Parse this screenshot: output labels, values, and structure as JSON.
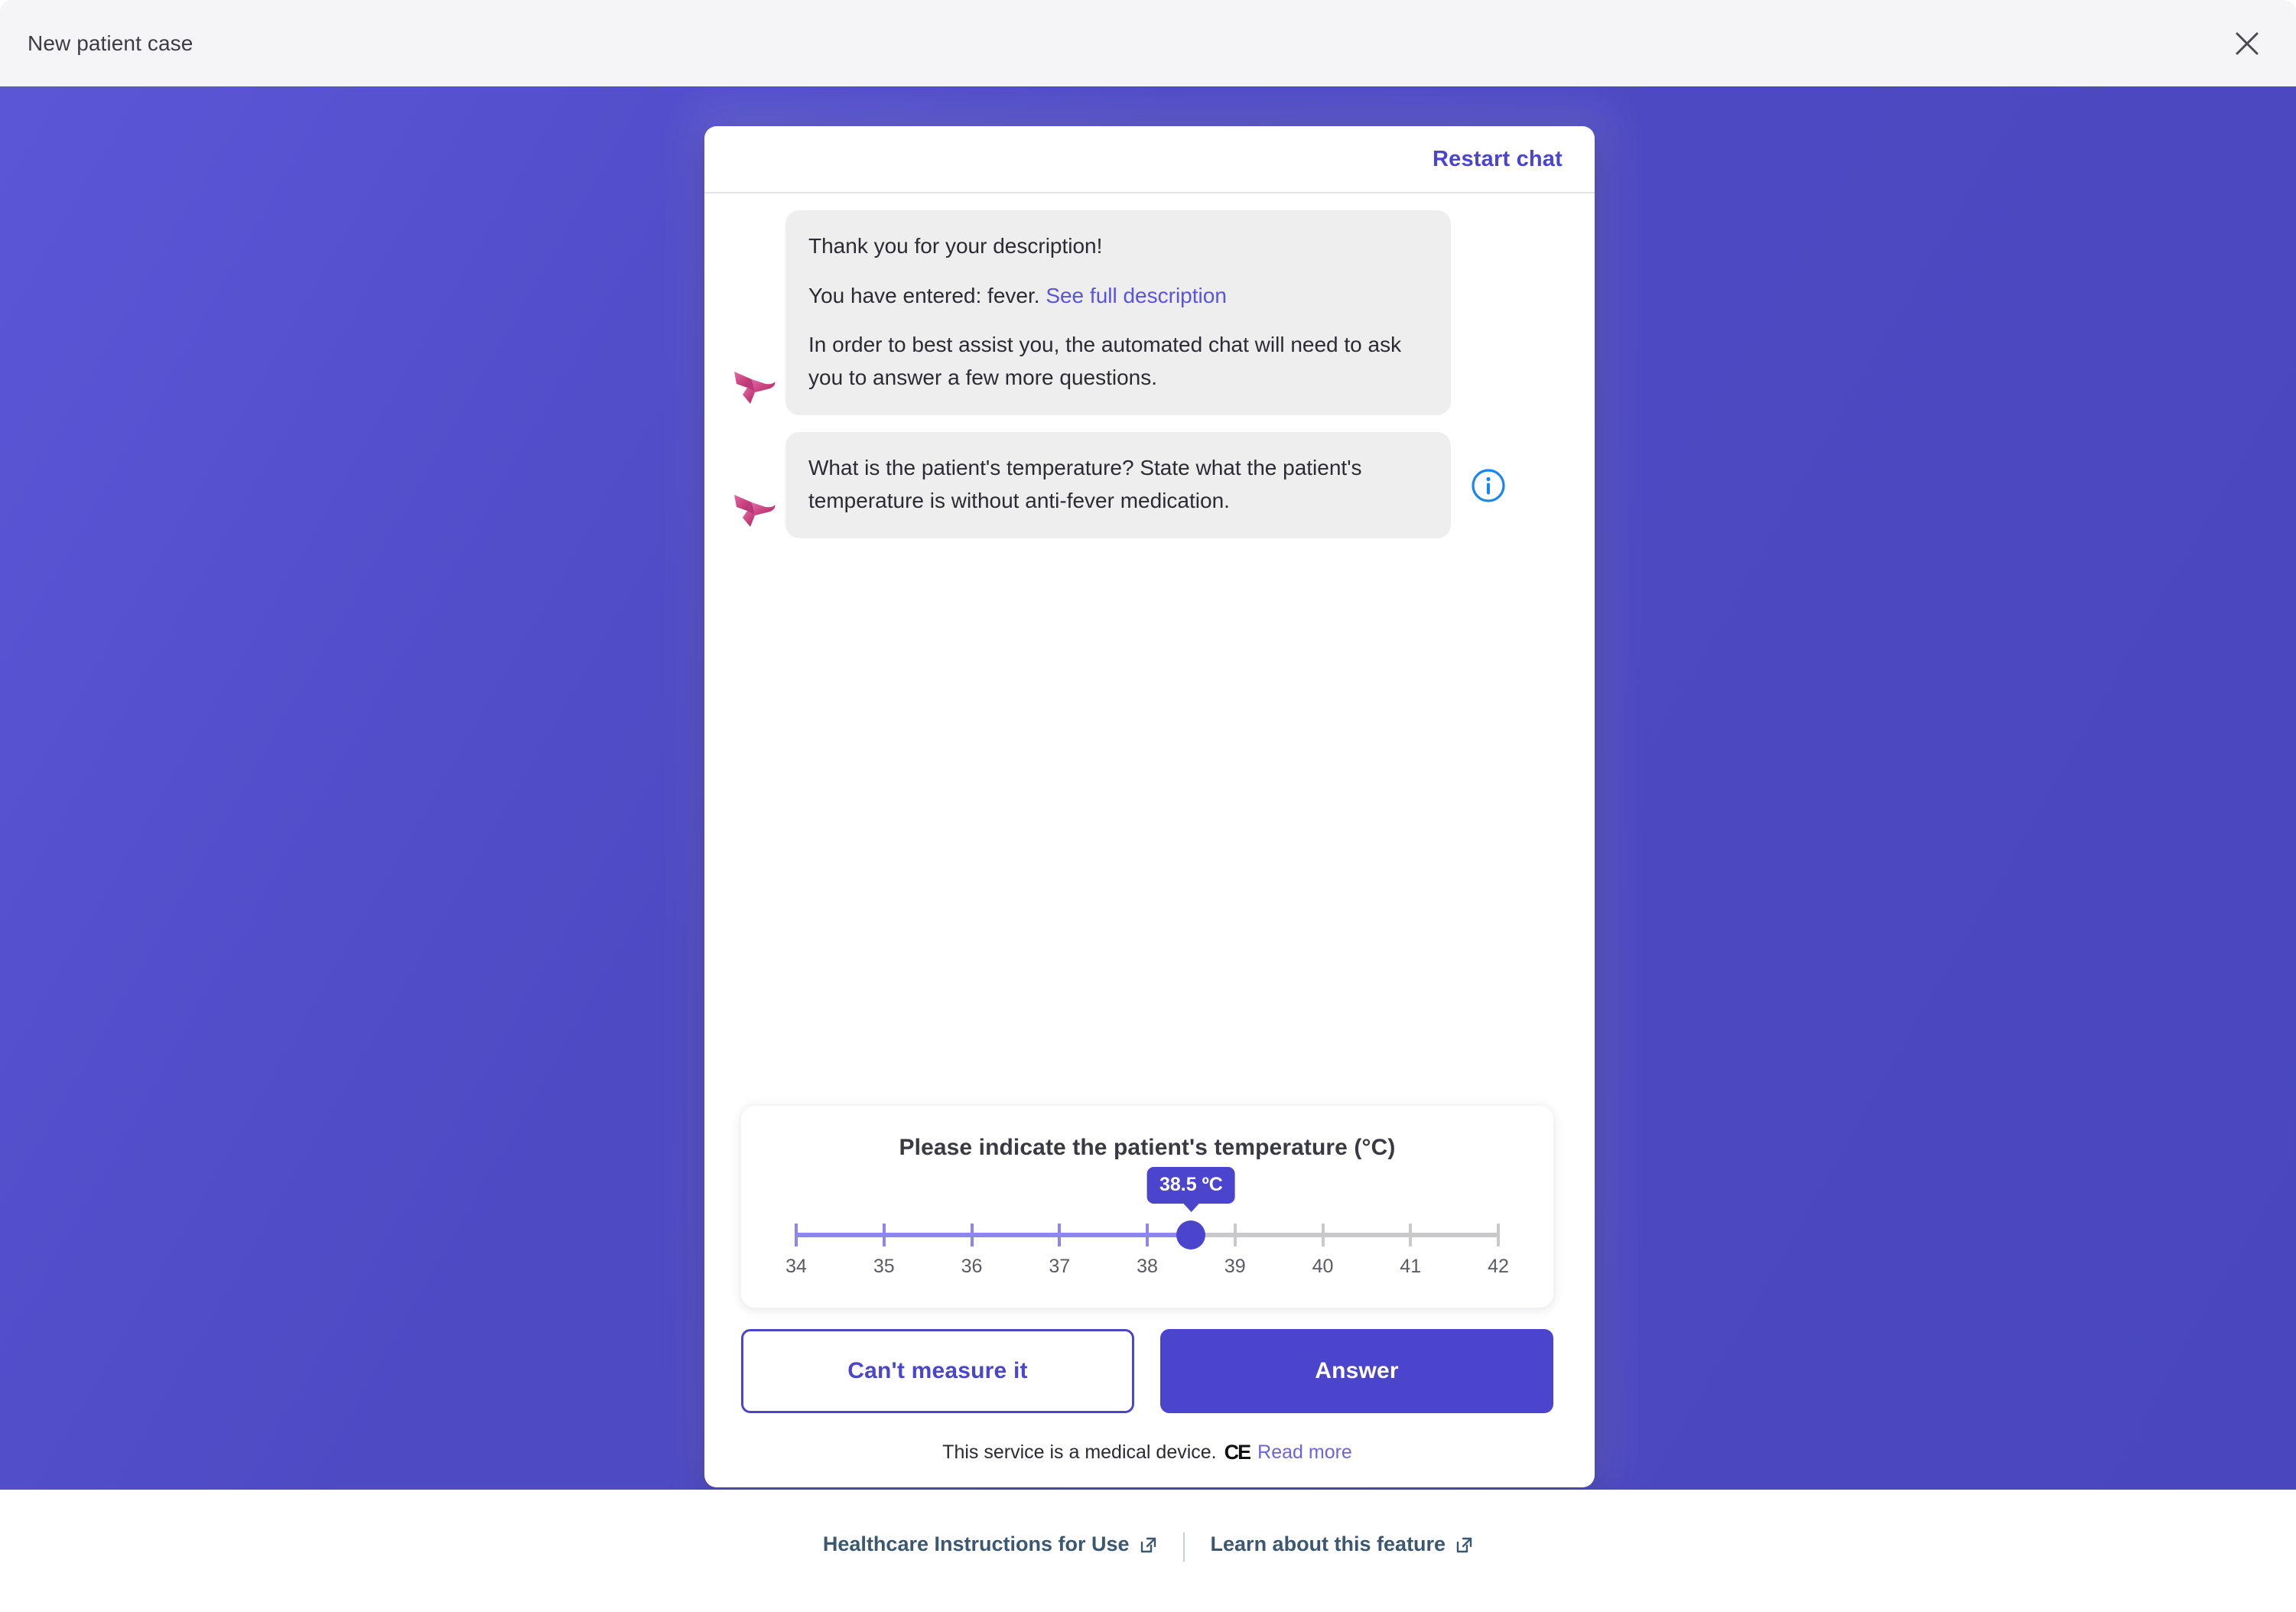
{
  "window": {
    "title": "New patient case",
    "close_icon": "close-icon"
  },
  "chat": {
    "restart_label": "Restart chat",
    "avatar_icon": "origami-bird-icon",
    "info_icon": "info-circle-icon",
    "messages": [
      {
        "paragraphs": [
          "Thank you for your description!",
          "You have entered: fever. ",
          "In order to best assist you, the automated chat will need to ask you to answer a few more questions."
        ],
        "link_text": "See full description",
        "has_info": false
      },
      {
        "paragraphs": [
          "What is the patient's temperature? State what the patient's temperature is without anti-fever medication."
        ],
        "has_info": true
      }
    ]
  },
  "slider_panel": {
    "title": "Please indicate the patient's temperature (°C)",
    "value_label": "38.5 ºC",
    "value": 38.5,
    "min": 34,
    "max": 42,
    "ticks": [
      "34",
      "35",
      "36",
      "37",
      "38",
      "39",
      "40",
      "41",
      "42"
    ]
  },
  "actions": {
    "secondary_label": "Can't measure it",
    "primary_label": "Answer"
  },
  "device_note": {
    "text": "This service is a medical device.",
    "ce_mark": "CE",
    "read_more": "Read more"
  },
  "footer": {
    "links": [
      {
        "label": "Healthcare Instructions for Use",
        "icon": "external-link-icon"
      },
      {
        "label": "Learn about this feature",
        "icon": "external-link-icon"
      }
    ]
  },
  "colors": {
    "brand_purple": "#4b45cd",
    "stage_purple": "#4e4ac4",
    "track_fill": "#8d86f0",
    "track_empty": "#c9c9cc",
    "link_blue": "#5a54d8",
    "info_blue": "#1a86f5",
    "bird_pink": "#c9437f",
    "footer_link": "#3c5871"
  }
}
